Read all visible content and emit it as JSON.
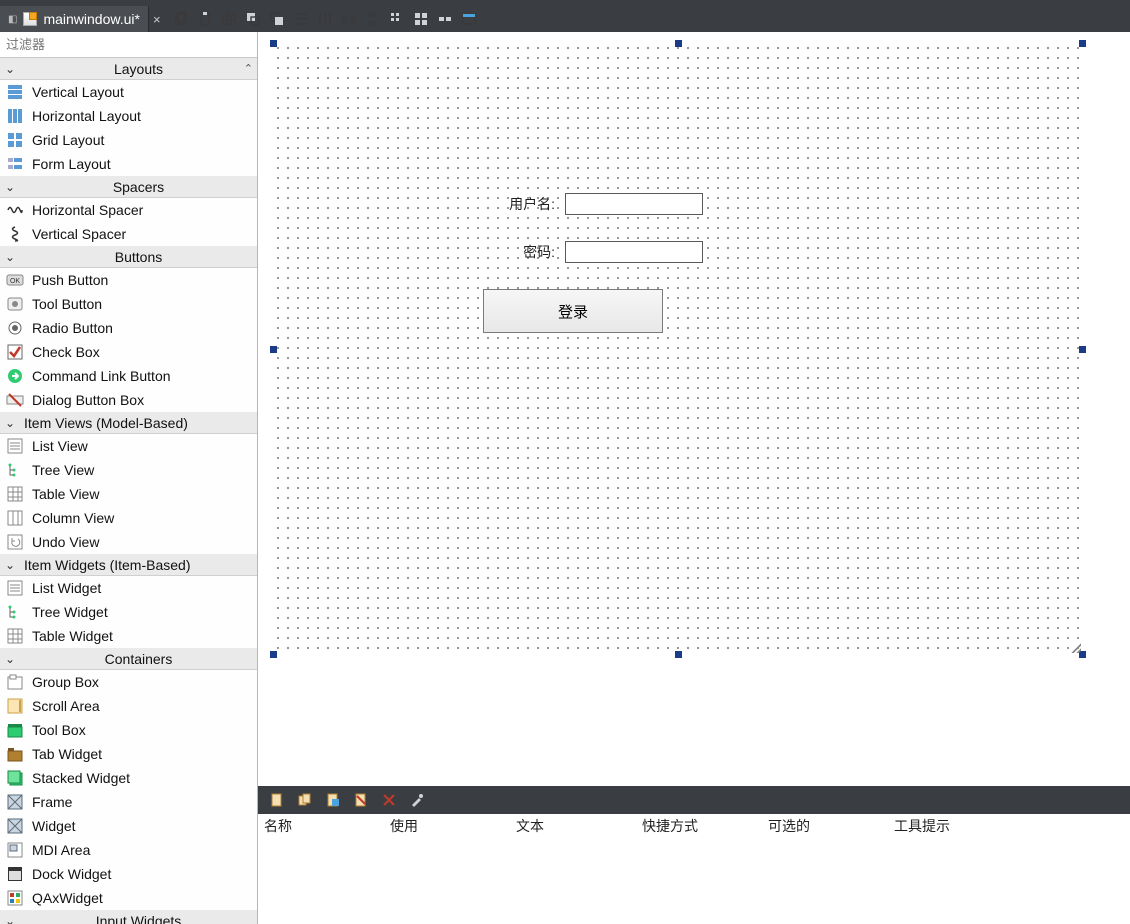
{
  "tab": {
    "title": "mainwindow.ui*",
    "close": "×"
  },
  "toolbar_icons": [
    "copy-icon",
    "paste-icon",
    "dup-icon",
    "send-back-icon",
    "bring-front-icon",
    "align-h-icon",
    "align-v-icon",
    "distribute-h-icon",
    "distribute-v-icon",
    "grid-small-icon",
    "grid-large-icon",
    "break-layout-icon",
    "preview-icon"
  ],
  "sidebar": {
    "filter_placeholder": "过滤器",
    "categories": [
      {
        "name": "Layouts",
        "show_up": true,
        "items": [
          {
            "icon": "vstack",
            "label": "Vertical Layout"
          },
          {
            "icon": "hstack",
            "label": "Horizontal Layout"
          },
          {
            "icon": "grid",
            "label": "Grid Layout"
          },
          {
            "icon": "form",
            "label": "Form Layout"
          }
        ]
      },
      {
        "name": "Spacers",
        "items": [
          {
            "icon": "hspring",
            "label": "Horizontal Spacer"
          },
          {
            "icon": "vspring",
            "label": "Vertical Spacer"
          }
        ]
      },
      {
        "name": "Buttons",
        "items": [
          {
            "icon": "okbtn",
            "label": "Push Button"
          },
          {
            "icon": "toolbtn",
            "label": "Tool Button"
          },
          {
            "icon": "radio",
            "label": "Radio Button"
          },
          {
            "icon": "check",
            "label": "Check Box"
          },
          {
            "icon": "cmdlink",
            "label": "Command Link Button"
          },
          {
            "icon": "dlgbtn",
            "label": "Dialog Button Box"
          }
        ]
      },
      {
        "name": "Item Views (Model-Based)",
        "align": "left",
        "items": [
          {
            "icon": "listv",
            "label": "List View"
          },
          {
            "icon": "treev",
            "label": "Tree View"
          },
          {
            "icon": "tablev",
            "label": "Table View"
          },
          {
            "icon": "colv",
            "label": "Column View"
          },
          {
            "icon": "undov",
            "label": "Undo View"
          }
        ]
      },
      {
        "name": "Item Widgets (Item-Based)",
        "align": "left",
        "items": [
          {
            "icon": "listv",
            "label": "List Widget"
          },
          {
            "icon": "treev",
            "label": "Tree Widget"
          },
          {
            "icon": "tablev",
            "label": "Table Widget"
          }
        ]
      },
      {
        "name": "Containers",
        "items": [
          {
            "icon": "group",
            "label": "Group Box"
          },
          {
            "icon": "scroll",
            "label": "Scroll Area"
          },
          {
            "icon": "toolbox",
            "label": "Tool Box"
          },
          {
            "icon": "tabw",
            "label": "Tab Widget"
          },
          {
            "icon": "stackw",
            "label": "Stacked Widget"
          },
          {
            "icon": "frame",
            "label": "Frame"
          },
          {
            "icon": "widget",
            "label": "Widget"
          },
          {
            "icon": "mdi",
            "label": "MDI Area"
          },
          {
            "icon": "dock",
            "label": "Dock Widget"
          },
          {
            "icon": "qax",
            "label": "QAxWidget"
          }
        ]
      },
      {
        "name": "Input Widgets",
        "collapsed_peek": true,
        "items": []
      }
    ]
  },
  "canvas": {
    "form": {
      "username_label": "用户名:",
      "password_label": "密码:",
      "login_button": "登录"
    }
  },
  "action_toolbar_icons": [
    "new-action-icon",
    "copy-action-icon",
    "paste-action-icon",
    "cut-action-icon",
    "delete-action-icon",
    "config-action-icon"
  ],
  "action_table": {
    "columns": {
      "name": "名称",
      "use": "使用",
      "text": "文本",
      "shortcut": "快捷方式",
      "checkable": "可选的",
      "tooltip": "工具提示"
    }
  }
}
